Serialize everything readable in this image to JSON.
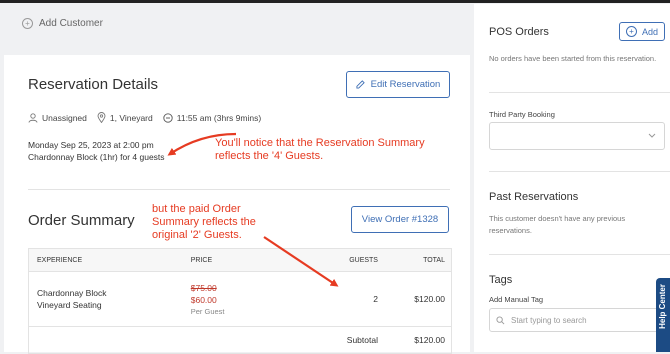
{
  "customer": {
    "add_label": "Add Customer"
  },
  "reservation": {
    "title": "Reservation Details",
    "edit_label": "Edit Reservation",
    "staff": "Unassigned",
    "location": "1, Vineyard",
    "time": "11:55 am (3hrs 9mins)",
    "date_line": "Monday Sep 25, 2023 at 2:00 pm",
    "block_line": "Chardonnay Block (1hr) for 4 guests"
  },
  "annotations": {
    "note1_line1": "You'll notice that the Reservation Summary",
    "note1_line2": "reflects the '4' Guests.",
    "note2_line1": "but the paid Order",
    "note2_line2": "Summary reflects the",
    "note2_line3": "original '2' Guests."
  },
  "order": {
    "title": "Order Summary",
    "view_label": "View Order #1328",
    "headers": {
      "experience": "EXPERIENCE",
      "price": "PRICE",
      "guests": "GUESTS",
      "total": "TOTAL"
    },
    "row": {
      "experience": "Chardonnay Block",
      "seating": "Vineyard Seating",
      "price_original": "$75.00",
      "price_current": "$60.00",
      "price_unit": "Per Guest",
      "guests": "2",
      "total": "$120.00"
    },
    "subtotal_label": "Subtotal",
    "subtotal_value": "$120.00"
  },
  "pos": {
    "title": "POS Orders",
    "add_label": "Add",
    "empty_text": "No orders have been started from this reservation."
  },
  "third_party": {
    "label": "Third Party Booking",
    "value": ""
  },
  "past": {
    "title": "Past Reservations",
    "empty_text": "This customer doesn't have any previous reservations."
  },
  "tags": {
    "title": "Tags",
    "manual_label": "Add Manual Tag",
    "search_placeholder": "Start typing to search"
  },
  "help": {
    "label": "Help Center"
  },
  "colors": {
    "accent": "#3f6fb5",
    "annotation": "#e63b22",
    "price_red": "#c0392b",
    "help_tab": "#1c4b84"
  }
}
